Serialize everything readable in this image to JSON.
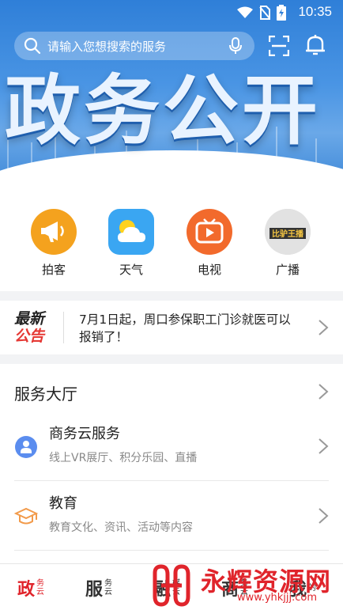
{
  "status_bar": {
    "time": "10:35"
  },
  "header": {
    "search_placeholder": "请输入您想搜索的服务",
    "banner_title": "政务公开"
  },
  "apps": [
    {
      "label": "拍客",
      "icon": "megaphone-icon",
      "color": "#f4a21e"
    },
    {
      "label": "天气",
      "icon": "weather-sun-cloud-icon",
      "color": "#3aa6f2"
    },
    {
      "label": "电视",
      "icon": "tv-play-icon",
      "color": "#f26a2c"
    },
    {
      "label": "广播",
      "icon": "radio-broadcast-icon",
      "color": "#555555",
      "logo_text": "比驴王播"
    }
  ],
  "notice": {
    "tag_line1": "最新",
    "tag_line2": "公告",
    "text": "7月1日起，周口参保职工门诊就医可以报销了！"
  },
  "services": {
    "heading": "服务大厅",
    "items": [
      {
        "title": "商务云服务",
        "subtitle": "线上VR展厅、积分乐园、直播",
        "icon": "user-badge-icon"
      },
      {
        "title": "教育",
        "subtitle": "教育文化、资讯、活动等内容",
        "icon": "graduation-cap-icon"
      }
    ]
  },
  "tabbar": {
    "tabs": [
      {
        "big": "政",
        "small": "务云",
        "color": "#e0242b"
      },
      {
        "big": "服",
        "small": "务云",
        "color": "#333333"
      },
      {
        "big": "融",
        "small": "媒云",
        "color": "#333333"
      },
      {
        "big": "商",
        "small": "务云",
        "color": "#333333"
      },
      {
        "big": "我",
        "small": "的",
        "color": "#333333"
      }
    ]
  },
  "watermark": {
    "text": "永辉资源网",
    "url": "www.yhkjjj.com"
  },
  "colors": {
    "accent": "#e0242b",
    "banner_blue": "#2f7fd8"
  }
}
